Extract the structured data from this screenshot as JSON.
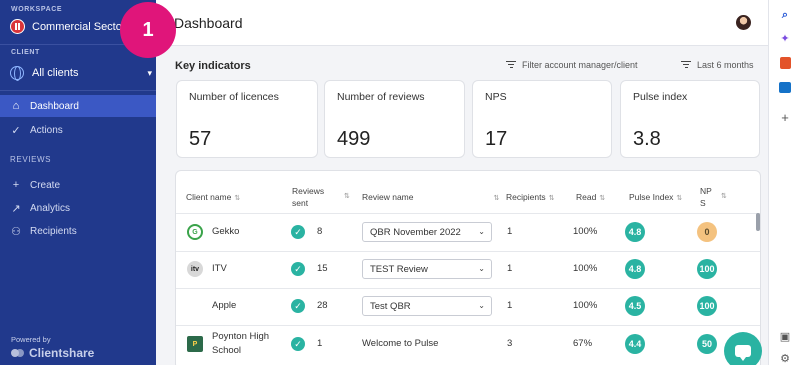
{
  "workspace": {
    "label": "WORKSPACE",
    "name": "Commercial Sector"
  },
  "step_badge": "1",
  "client": {
    "label": "CLIENT",
    "selected": "All clients"
  },
  "nav": {
    "dashboard": "Dashboard",
    "actions": "Actions",
    "reviews_section": "REVIEWS",
    "create": "Create",
    "analytics": "Analytics",
    "recipients": "Recipients"
  },
  "branding": {
    "powered_by": "Powered by",
    "name": "Clientshare"
  },
  "header": {
    "title": "Dashboard"
  },
  "key_indicators": {
    "title": "Key indicators",
    "filter_label": "Filter account manager/client",
    "period_label": "Last 6 months",
    "cards": [
      {
        "label": "Number of licences",
        "value": "57"
      },
      {
        "label": "Number of reviews",
        "value": "499"
      },
      {
        "label": "NPS",
        "value": "17"
      },
      {
        "label": "Pulse index",
        "value": "3.8"
      }
    ]
  },
  "table": {
    "headers": {
      "client_name": "Client name",
      "reviews_sent_1": "Reviews",
      "reviews_sent_2": "sent",
      "review_name": "Review name",
      "recipients": "Recipients",
      "read": "Read",
      "pulse_index": "Pulse Index",
      "nps_1": "NP",
      "nps_2": "S"
    },
    "rows": [
      {
        "client": "Gekko",
        "icon_text": "G",
        "reviews_sent": "8",
        "review_name": "QBR November 2022",
        "recipients": "1",
        "read": "100%",
        "pulse": "4.8",
        "nps": "0"
      },
      {
        "client": "ITV",
        "icon_text": "itv",
        "reviews_sent": "15",
        "review_name": "TEST Review",
        "recipients": "1",
        "read": "100%",
        "pulse": "4.8",
        "nps": "100"
      },
      {
        "client": "Apple",
        "icon_text": "",
        "reviews_sent": "28",
        "review_name": "Test QBR",
        "recipients": "1",
        "read": "100%",
        "pulse": "4.5",
        "nps": "100"
      },
      {
        "client_line1": "Poynton High",
        "client_line2": "School",
        "icon_text": "P",
        "reviews_sent": "1",
        "review_name": "Welcome to Pulse",
        "recipients": "3",
        "read": "67%",
        "pulse": "4.4",
        "nps": "50"
      }
    ]
  },
  "icons": {
    "sort": "⇅",
    "check": "✓",
    "chevron": "⌄",
    "apple": ""
  },
  "colors": {
    "sidebar": "#21398c",
    "active_nav": "#3b58c4",
    "teal": "#2ab3a2",
    "amber": "#f4c27f",
    "badge": "#e0157a"
  }
}
